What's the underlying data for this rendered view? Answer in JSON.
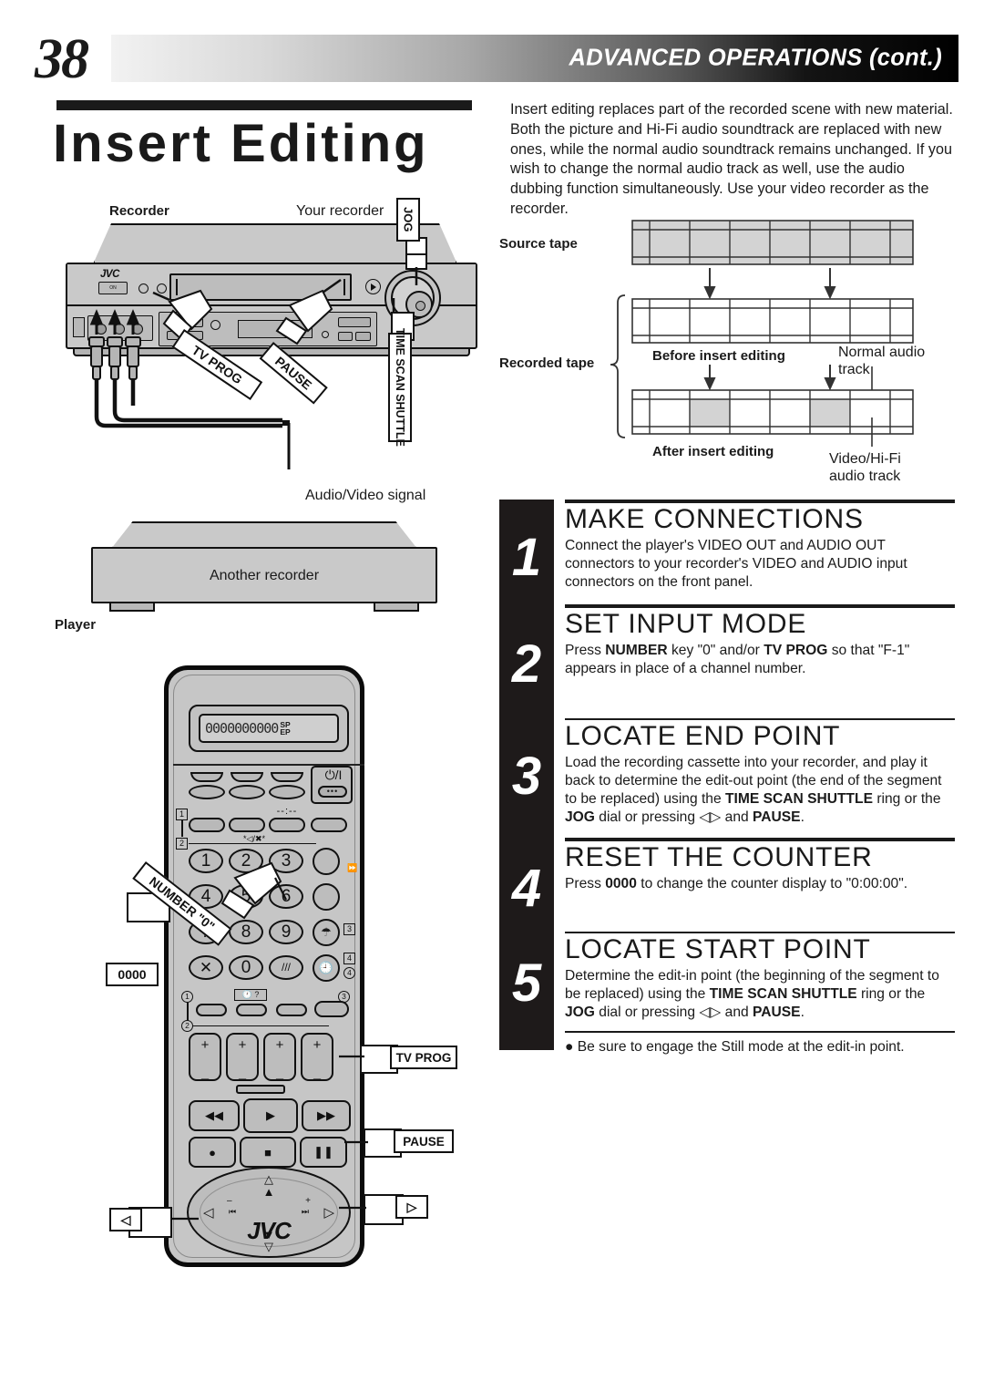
{
  "header": {
    "page_number": "38",
    "title": "ADVANCED OPERATIONS (cont.)"
  },
  "page_title": "Insert Editing",
  "intro": "Insert editing replaces part of the recorded scene with new material. Both the picture and Hi-Fi audio soundtrack are replaced with new ones, while the normal audio soundtrack remains unchanged. If you wish to change the normal audio track as well, use the audio dubbing function simultaneously. Use your video recorder as the recorder.",
  "recorder_diagram": {
    "label_recorder": "Recorder",
    "label_your_recorder": "Your recorder",
    "label_av_signal": "Audio/Video signal",
    "label_another_recorder": "Another recorder",
    "label_player": "Player",
    "brand": "JVC",
    "power_label": "ON",
    "callouts": {
      "jog": "JOG",
      "time_scan_shuttle": "TIME SCAN SHUTTLE",
      "tv_prog": "TV PROG",
      "pause": "PAUSE"
    }
  },
  "remote": {
    "lcd_digits": "0000000000",
    "lcd_mode_top": "SP",
    "lcd_mode_bottom": "EP",
    "brand": "JVC",
    "power_icon": "⏻/I",
    "clock_dash": "--:--",
    "aux_label": "*◁/✖*",
    "number_keys": [
      "1",
      "2",
      "3",
      "4",
      "5",
      "6",
      "7",
      "8",
      "9",
      "0"
    ],
    "cancel_key": "✕",
    "markers": [
      "1",
      "2",
      "3",
      "4"
    ],
    "callouts": {
      "number_zero": "NUMBER \"0\"",
      "counter_reset": "0000",
      "tv_prog": "TV PROG",
      "pause": "PAUSE",
      "left_arrow": "◁",
      "right_arrow": "▷"
    },
    "volume_plus": "+",
    "volume_minus": "–"
  },
  "tape_diagram": {
    "source_tape": "Source tape",
    "recorded_tape": "Recorded tape",
    "before_insert": "Before insert editing",
    "after_insert": "After insert editing",
    "normal_audio_track": "Normal audio\ntrack",
    "normal_audio_track_l1": "Normal audio",
    "normal_audio_track_l2": "track",
    "video_hifi_track_l1": "Video/Hi-Fi",
    "video_hifi_track_l2": "audio track"
  },
  "steps": [
    {
      "number": "1",
      "heading": "MAKE CONNECTIONS",
      "body_html": "Connect the player's VIDEO OUT and AUDIO OUT connectors to your recorder's VIDEO and AUDIO input connectors on the front panel."
    },
    {
      "number": "2",
      "heading": "SET INPUT MODE",
      "body_html": "Press <b>NUMBER</b> key \"0\" and/or <b>TV PROG</b> so that \"F-1\" appears in place of a channel number."
    },
    {
      "number": "3",
      "heading": "LOCATE END POINT",
      "body_html": "Load the recording cassette into your recorder, and play it back to determine the edit-out point (the end of the segment to be replaced) using the <b>TIME SCAN SHUTTLE</b> ring or the <b>JOG</b> dial or pressing ◁▷ and <b>PAUSE</b>."
    },
    {
      "number": "4",
      "heading": "RESET THE COUNTER",
      "body_html": "Press <b>0000</b> to change the counter display to \"0:00:00\"."
    },
    {
      "number": "5",
      "heading": "LOCATE START POINT",
      "body_html": "Determine the edit-in point (the beginning of the segment to be replaced) using the <b>TIME SCAN SHUTTLE</b> ring or the <b>JOG</b> dial or pressing ◁▷ and <b>PAUSE</b>."
    }
  ],
  "note": "● Be sure to engage the Still mode at the edit-in point."
}
